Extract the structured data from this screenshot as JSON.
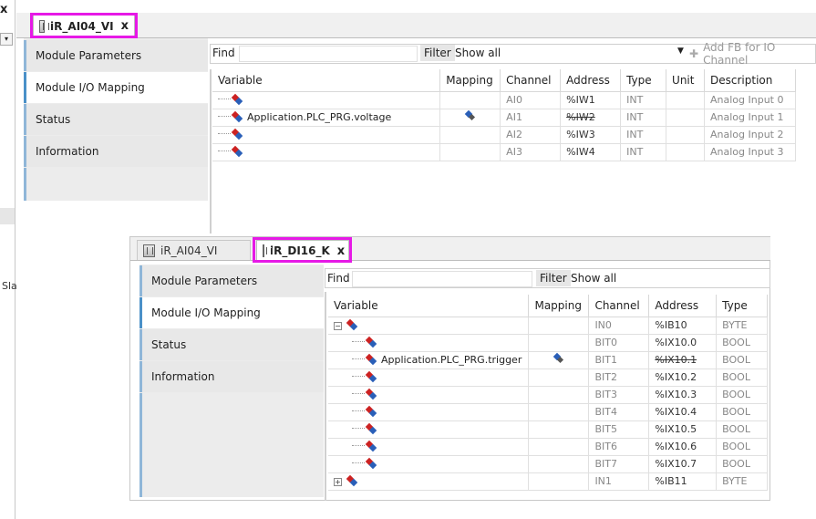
{
  "left_strip": {
    "close_glyph": "x",
    "dropdown_glyph": "▾",
    "partial_text": "Sla"
  },
  "top_window": {
    "tab": {
      "label": "iR_AI04_VI",
      "close": "x"
    },
    "nav": [
      "Module Parameters",
      "Module I/O Mapping",
      "Status",
      "Information"
    ],
    "find_label": "Find",
    "filter_label": "Filter",
    "filter_value": "Show all",
    "add_fb_label": "Add FB for IO Channel",
    "columns": [
      "Variable",
      "Mapping",
      "Channel",
      "Address",
      "Type",
      "Unit",
      "Description"
    ],
    "rows": [
      {
        "variable": "",
        "mapped": false,
        "channel": "AI0",
        "address": "%IW1",
        "struck": false,
        "type": "INT",
        "unit": "",
        "description": "Analog Input 0"
      },
      {
        "variable": "Application.PLC_PRG.voltage",
        "mapped": true,
        "channel": "AI1",
        "address": "%IW2",
        "struck": true,
        "type": "INT",
        "unit": "",
        "description": "Analog Input 1"
      },
      {
        "variable": "",
        "mapped": false,
        "channel": "AI2",
        "address": "%IW3",
        "struck": false,
        "type": "INT",
        "unit": "",
        "description": "Analog Input 2"
      },
      {
        "variable": "",
        "mapped": false,
        "channel": "AI3",
        "address": "%IW4",
        "struck": false,
        "type": "INT",
        "unit": "",
        "description": "Analog Input 3"
      }
    ]
  },
  "bottom_window": {
    "tabs": [
      {
        "label": "iR_AI04_VI",
        "active": false
      },
      {
        "label": "iR_DI16_K",
        "active": true,
        "close": "x"
      }
    ],
    "nav": [
      "Module Parameters",
      "Module I/O Mapping",
      "Status",
      "Information"
    ],
    "find_label": "Find",
    "filter_label": "Filter",
    "filter_value": "Show all",
    "columns": [
      "Variable",
      "Mapping",
      "Channel",
      "Address",
      "Type"
    ],
    "rows": [
      {
        "level": 0,
        "expander": "−",
        "variable": "",
        "mapped": false,
        "channel": "IN0",
        "address": "%IB10",
        "struck": false,
        "type": "BYTE"
      },
      {
        "level": 1,
        "expander": "",
        "variable": "",
        "mapped": false,
        "channel": "BIT0",
        "address": "%IX10.0",
        "struck": false,
        "type": "BOOL"
      },
      {
        "level": 1,
        "expander": "",
        "variable": "Application.PLC_PRG.trigger",
        "mapped": true,
        "channel": "BIT1",
        "address": "%IX10.1",
        "struck": true,
        "type": "BOOL"
      },
      {
        "level": 1,
        "expander": "",
        "variable": "",
        "mapped": false,
        "channel": "BIT2",
        "address": "%IX10.2",
        "struck": false,
        "type": "BOOL"
      },
      {
        "level": 1,
        "expander": "",
        "variable": "",
        "mapped": false,
        "channel": "BIT3",
        "address": "%IX10.3",
        "struck": false,
        "type": "BOOL"
      },
      {
        "level": 1,
        "expander": "",
        "variable": "",
        "mapped": false,
        "channel": "BIT4",
        "address": "%IX10.4",
        "struck": false,
        "type": "BOOL"
      },
      {
        "level": 1,
        "expander": "",
        "variable": "",
        "mapped": false,
        "channel": "BIT5",
        "address": "%IX10.5",
        "struck": false,
        "type": "BOOL"
      },
      {
        "level": 1,
        "expander": "",
        "variable": "",
        "mapped": false,
        "channel": "BIT6",
        "address": "%IX10.6",
        "struck": false,
        "type": "BOOL"
      },
      {
        "level": 1,
        "expander": "",
        "variable": "",
        "mapped": false,
        "channel": "BIT7",
        "address": "%IX10.7",
        "struck": false,
        "type": "BOOL"
      },
      {
        "level": 0,
        "expander": "+",
        "variable": "",
        "mapped": false,
        "channel": "IN1",
        "address": "%IB11",
        "struck": false,
        "type": "BYTE"
      }
    ]
  },
  "colors": {
    "highlight": "#e619e6",
    "nav_accent": "#4a90c8"
  }
}
